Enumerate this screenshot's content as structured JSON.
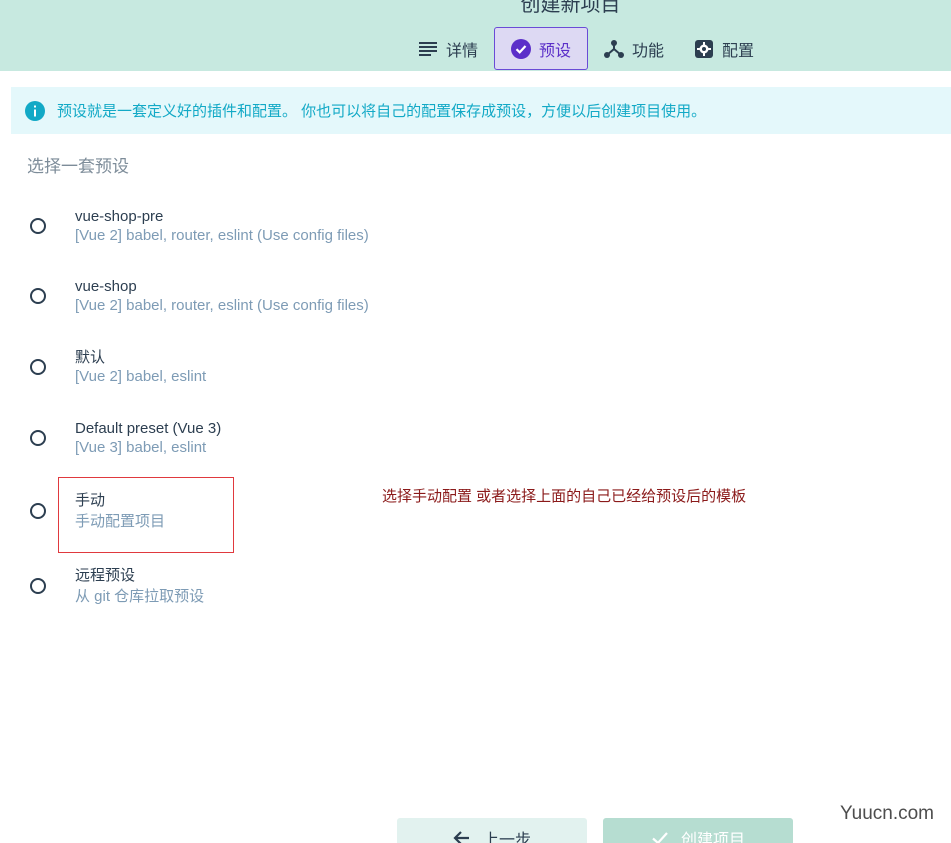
{
  "header": {
    "title": "创建新项目",
    "tabs": [
      {
        "label": "详情",
        "icon": "list-icon",
        "active": false
      },
      {
        "label": "预设",
        "icon": "check-circle-icon",
        "active": true
      },
      {
        "label": "功能",
        "icon": "fork-icon",
        "active": false
      },
      {
        "label": "配置",
        "icon": "gear-icon",
        "active": false
      }
    ]
  },
  "info": {
    "icon": "info-icon",
    "text": "预设就是一套定义好的插件和配置。 你也可以将自己的配置保存成预设，方便以后创建项目使用。"
  },
  "section_title": "选择一套预设",
  "presets": [
    {
      "name": "vue-shop-pre",
      "desc": "[Vue 2] babel, router, eslint (Use config files)"
    },
    {
      "name": "vue-shop",
      "desc": "[Vue 2] babel, router, eslint (Use config files)"
    },
    {
      "name": "默认",
      "desc": "[Vue 2] babel, eslint"
    },
    {
      "name": "Default preset (Vue 3)",
      "desc": "[Vue 3] babel, eslint"
    },
    {
      "name": "手动",
      "desc": "手动配置项目"
    },
    {
      "name": "远程预设",
      "desc": "从 git 仓库拉取预设"
    }
  ],
  "annotation": "选择手动配置 或者选择上面的自己已经给预设后的模板",
  "buttons": {
    "prev_label": "上一步",
    "create_label": "创建项目"
  },
  "watermark": "Yuucn.com",
  "colors": {
    "header_bg": "#c7e9e0",
    "accent": "#5b2fc9",
    "info_text": "#12a9c6",
    "annotation": "#8b1a1a",
    "highlight_border": "#e0393e"
  }
}
